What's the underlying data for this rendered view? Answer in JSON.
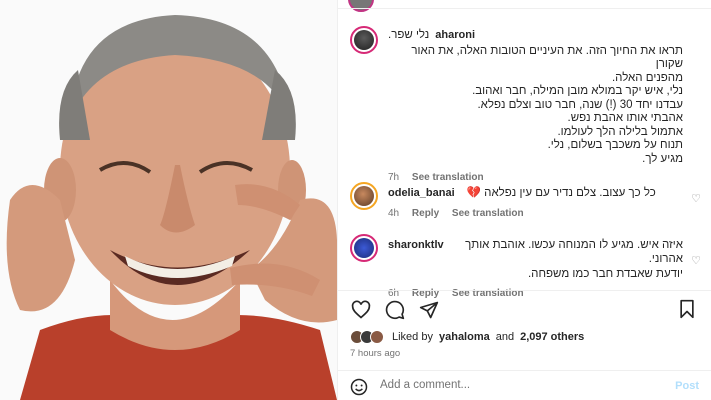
{
  "post": {
    "photo_alt": "smiling man",
    "comments": [
      {
        "username": "aharoni",
        "lines": [
          "נלי שפר.",
          "תראו את החיוך הזה. את העיניים הטובות האלה, את האור שקורן",
          "מהפנים האלה.",
          "נלי, איש יקר במולא מובן המילה, חבר ואהוב.",
          "עבדנו יחד 30 (!) שנה, חבר טוב וצלם נפלא.",
          "אהבתי אותו אהבת נפש.",
          "אתמול בלילה הלך לעולמו.",
          "תנוח על משכבך בשלום, נלי.",
          "מגיע לך."
        ],
        "time": "7h",
        "see_translation": "See translation"
      },
      {
        "username": "odelia_banai",
        "text": "כל כך עצוב. צלם נדיר עם עין נפלאה 💔",
        "time": "4h",
        "reply": "Reply",
        "see_translation": "See translation"
      },
      {
        "username": "sharonktlv",
        "lines": [
          "איזה איש. מגיע לו המנוחה עכשו. אוהבת אותך אהרוני.",
          "יודעת שאבדת חבר כמו משפחה."
        ],
        "time": "6h",
        "reply": "Reply",
        "see_translation": "See translation"
      }
    ],
    "likes": {
      "prefix": "Liked by",
      "user": "yahaloma",
      "and": "and",
      "count": "2,097 others"
    },
    "time_ago": "7 hours ago",
    "add_comment": {
      "placeholder": "Add a comment...",
      "post_label": "Post"
    }
  },
  "icons": [
    "heart-icon",
    "comment-icon",
    "share-icon",
    "bookmark-icon",
    "emoji-icon"
  ],
  "colors": {
    "accent_ring": "#d62976",
    "link_disabled": "#b2dffc",
    "meta": "#737373"
  }
}
